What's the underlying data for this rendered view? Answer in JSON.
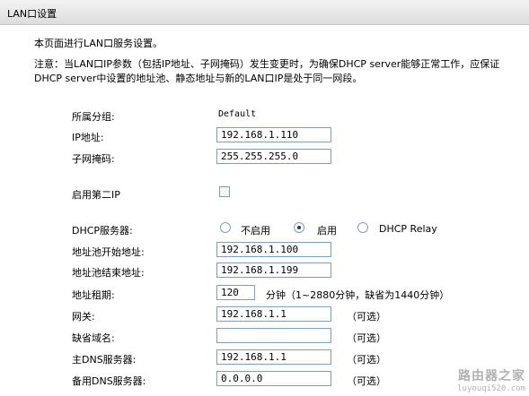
{
  "header": {
    "title": "LAN口设置"
  },
  "intro": "本页面进行LAN口服务设置。",
  "note": "注意：当LAN口IP参数（包括IP地址、子网掩码）发生变更时，为确保DHCP server能够正常工作，应保证DHCP server中设置的地址池、静态地址与新的LAN口IP是处于同一网段。",
  "group": {
    "label": "所属分组:",
    "value": "Default"
  },
  "ip": {
    "label": "IP地址:",
    "value": "192.168.1.110"
  },
  "mask": {
    "label": "子网掩码:",
    "value": "255.255.255.0"
  },
  "second_ip": {
    "label": "启用第二IP",
    "checked": false
  },
  "dhcp": {
    "label": "DHCP服务器:",
    "options": [
      "不启用",
      "启用",
      "DHCP Relay"
    ],
    "selected": "启用"
  },
  "pool_start": {
    "label": "地址池开始地址:",
    "value": "192.168.1.100"
  },
  "pool_end": {
    "label": "地址池结束地址:",
    "value": "192.168.1.199"
  },
  "lease": {
    "label": "地址租期:",
    "value": "120",
    "unit": "分钟（1~2880分钟，缺省为1440分钟）"
  },
  "gateway": {
    "label": "网关:",
    "value": "192.168.1.1",
    "optional": "（可选）"
  },
  "domain": {
    "label": "缺省域名:",
    "value": "",
    "optional": "（可选）"
  },
  "dns1": {
    "label": "主DNS服务器:",
    "value": "192.168.1.1",
    "optional": "（可选）"
  },
  "dns2": {
    "label": "备用DNS服务器:",
    "value": "0.0.0.0",
    "optional": "（可选）"
  },
  "watermark": {
    "line1": "路由器之家",
    "line2": "luyouqi520.com"
  }
}
